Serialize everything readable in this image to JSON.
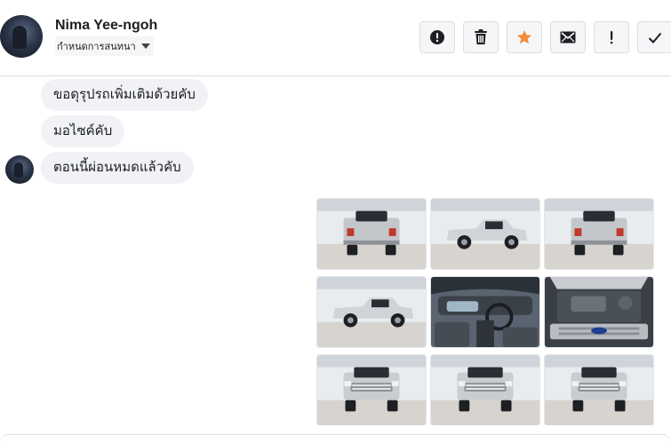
{
  "contact": {
    "name": "Nima Yee-ngoh",
    "status_label": "กำหนดการสนทนา"
  },
  "toolbar": {
    "buttons": [
      {
        "name": "mark-spam-button",
        "icon": "alert-circle-icon",
        "color": "#1c1e21"
      },
      {
        "name": "delete-button",
        "icon": "trash-icon",
        "color": "#1c1e21"
      },
      {
        "name": "star-button",
        "icon": "star-icon",
        "color": "#f5893a"
      },
      {
        "name": "mark-unread-button",
        "icon": "envelope-icon",
        "color": "#1c1e21"
      },
      {
        "name": "follow-up-button",
        "icon": "exclamation-icon",
        "color": "#1c1e21"
      },
      {
        "name": "mark-done-button",
        "icon": "checkmark-icon",
        "color": "#1c1e21"
      }
    ]
  },
  "messages": [
    {
      "text": "ขอดุรุปรถเพิ่มเติมด้วยคับ"
    },
    {
      "text": "มอไซค์คับ"
    },
    {
      "text": "ตอนนี้ผ่อนหมดแล้วคับ"
    }
  ],
  "photos": [
    {
      "name": "photo-truck-rear",
      "view": "rear"
    },
    {
      "name": "photo-truck-side",
      "view": "side"
    },
    {
      "name": "photo-truck-rear-right",
      "view": "rear"
    },
    {
      "name": "photo-truck-side-left",
      "view": "side"
    },
    {
      "name": "photo-truck-interior",
      "view": "interior"
    },
    {
      "name": "photo-truck-engine",
      "view": "engine"
    },
    {
      "name": "photo-truck-front-left",
      "view": "front"
    },
    {
      "name": "photo-truck-front",
      "view": "front"
    },
    {
      "name": "photo-truck-front-right",
      "view": "front"
    }
  ]
}
